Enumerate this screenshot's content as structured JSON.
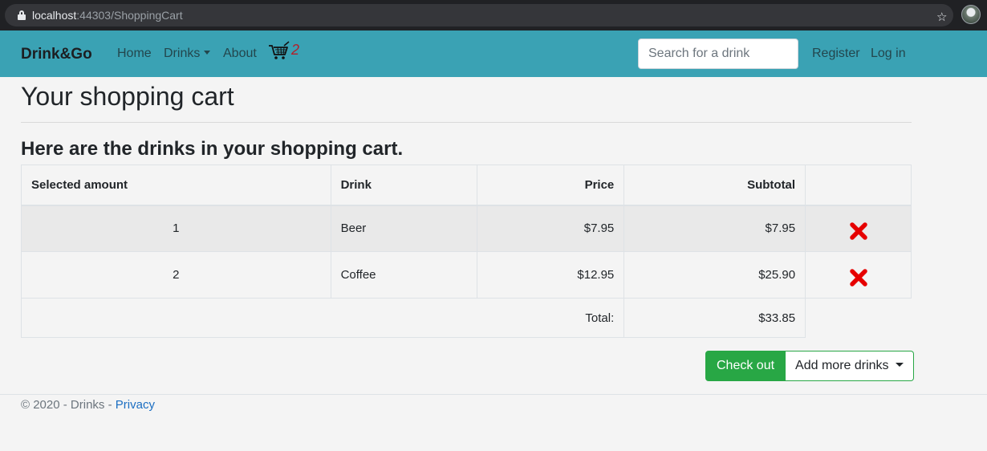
{
  "browser": {
    "url_host": "localhost",
    "url_path": ":44303/ShoppingCart"
  },
  "navbar": {
    "brand": "Drink&Go",
    "links": {
      "home": "Home",
      "drinks": "Drinks",
      "about": "About"
    },
    "cart_count": "2",
    "search_placeholder": "Search for a drink",
    "register": "Register",
    "login": "Log in",
    "colors": {
      "background": "#3aa2b4"
    }
  },
  "page": {
    "title": "Your shopping cart",
    "subtitle": "Here are the drinks in your shopping cart."
  },
  "cart_table": {
    "headers": {
      "amount": "Selected amount",
      "drink": "Drink",
      "price": "Price",
      "subtotal": "Subtotal"
    },
    "rows": [
      {
        "amount": "1",
        "drink": "Beer",
        "price": "$7.95",
        "subtotal": "$7.95",
        "remove_icon": "remove-x-icon"
      },
      {
        "amount": "2",
        "drink": "Coffee",
        "price": "$12.95",
        "subtotal": "$25.90",
        "remove_icon": "remove-x-icon"
      }
    ],
    "total_label": "Total:",
    "total_value": "$33.85"
  },
  "actions": {
    "checkout": "Check out",
    "add_more": "Add more drinks",
    "colors": {
      "checkout": "#28a745"
    }
  },
  "footer": {
    "text": "© 2020 - Drinks - ",
    "privacy": "Privacy"
  }
}
